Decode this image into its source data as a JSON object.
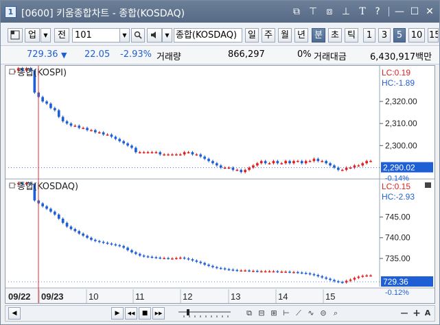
{
  "window": {
    "title": "[0600] 키움종합차트 - 종합(KOSDAQ)",
    "icon_label": "1",
    "controls": [
      "new-window-icon",
      "pin-icon",
      "restore-icon",
      "extend-icon",
      "font-icon",
      "help-icon",
      "minimize-icon",
      "maximize-icon",
      "close-icon"
    ],
    "control_glyphs": [
      "⧉",
      "⊤",
      "⧈",
      "⊥",
      "T",
      "?",
      "—",
      "☐",
      "✕"
    ]
  },
  "toolbar": {
    "type_label": "업",
    "all_label": "전",
    "code_value": "101",
    "market_name": "종합(KOSDAQ)",
    "periods": [
      "일",
      "주",
      "월",
      "년",
      "분",
      "초",
      "틱"
    ],
    "active_period": "분",
    "intervals": [
      "1",
      "3",
      "5",
      "10",
      "15"
    ],
    "active_interval": "5"
  },
  "info": {
    "price": "729.36",
    "change": "22.05",
    "change_pct": "-2.93%",
    "volume_label": "거래량",
    "volume": "866,297",
    "volume_pct": "0%",
    "amount_label": "거래대금",
    "amount": "6,430,917백만"
  },
  "chart_data": [
    {
      "type": "candlestick",
      "title": "종합(KOSPI)",
      "lc_label": "LC:0.19",
      "hc_label": "HC:-1.89",
      "y_ticks": [
        "2,320.00",
        "2,310.00",
        "2,300.00"
      ],
      "y_tick_values": [
        2320,
        2310,
        2300
      ],
      "ylim": [
        2285.5,
        2335.5
      ],
      "current_value": "2,290.02",
      "current_pct": "-0.14%",
      "current": 2290.02,
      "series": [
        2333,
        2334,
        2335,
        2334,
        2335,
        2334,
        2324,
        2322,
        2320,
        2319,
        2317,
        2316,
        2313,
        2311,
        2310,
        2309,
        2309,
        2308,
        2308,
        2307,
        2307,
        2306,
        2306,
        2305,
        2305,
        2304,
        2303,
        2302,
        2301,
        2300,
        2299,
        2297,
        2297,
        2297,
        2297,
        2297,
        2297,
        2296,
        2296,
        2296,
        2296,
        2296,
        2296,
        2297,
        2297,
        2296,
        2296,
        2295,
        2294,
        2293,
        2292,
        2291,
        2290,
        2290,
        2290,
        2289,
        2289,
        2288,
        2289,
        2290,
        2291,
        2292,
        2293,
        2292,
        2292,
        2293,
        2292,
        2292,
        2293,
        2292,
        2293,
        2293,
        2292,
        2293,
        2293,
        2294,
        2293,
        2293,
        2292,
        2291,
        2290,
        2289,
        2289,
        2290,
        2290,
        2291,
        2291,
        2292,
        2293,
        2293
      ]
    },
    {
      "type": "candlestick",
      "title": "종합(KOSDAQ)",
      "lc_label": "LC:0.15",
      "hc_label": "HC:-2.93",
      "y_ticks": [
        "745.00",
        "740.00",
        "735.00"
      ],
      "y_tick_values": [
        745,
        740,
        735
      ],
      "ylim": [
        728.2,
        753.7
      ],
      "current_value": "729.36",
      "current_pct": "-0.12%",
      "current": 729.36,
      "series": [
        752.8,
        753.0,
        753.2,
        752.9,
        753.2,
        753.0,
        749.0,
        748.3,
        747.6,
        747.0,
        746.3,
        745.6,
        744.6,
        743.6,
        742.7,
        742.1,
        741.6,
        741.0,
        740.5,
        740.0,
        739.5,
        739.2,
        739.0,
        738.8,
        738.6,
        738.4,
        738.2,
        738.0,
        737.6,
        737.0,
        736.5,
        736.1,
        735.7,
        735.5,
        735.4,
        735.3,
        735.2,
        735.1,
        735.1,
        735.0,
        735.0,
        735.1,
        735.2,
        735.0,
        734.8,
        734.5,
        734.2,
        733.9,
        733.5,
        733.2,
        732.9,
        732.7,
        732.6,
        732.4,
        732.3,
        732.2,
        732.1,
        732.1,
        732.1,
        732.0,
        732.0,
        731.9,
        731.9,
        731.9,
        731.9,
        731.9,
        731.8,
        731.8,
        731.8,
        731.7,
        731.7,
        731.6,
        731.5,
        731.4,
        731.2,
        731.0,
        730.7,
        730.4,
        730.1,
        729.8,
        729.5,
        729.3,
        729.2,
        729.6,
        729.9,
        730.3,
        730.6,
        730.8,
        730.9,
        730.9
      ]
    }
  ],
  "time_axis": {
    "labels": [
      "09/22",
      "09/23",
      "10",
      "11",
      "12",
      "13",
      "14",
      "15"
    ]
  },
  "colors": {
    "up": "#e02020",
    "down": "#1f5fd6",
    "crosshair": "#e03030",
    "accent_blue": "#1f5fd6",
    "current_bg": "#1f5fd6"
  },
  "scrollbar": {
    "buttons": [
      "scroll-left-icon",
      "scroll-right-icon",
      "play-icon",
      "rewind-icon",
      "stop-icon",
      "fast-forward-icon"
    ],
    "button_glyphs": [
      "◀",
      "▶",
      "◀◀",
      "■",
      "▶▶"
    ],
    "tools": [
      "copy-icon",
      "compare-icon",
      "settings-icon",
      "line-tool-icon",
      "trend-icon",
      "wave-icon",
      "lock-icon",
      "search-icon",
      "zoom-out-icon",
      "zoom-in-icon",
      "text-icon"
    ],
    "tool_glyphs": [
      "⧉",
      "⊟",
      "⊞",
      "⊢",
      "⟋",
      "∿",
      "⊝",
      "⌕",
      "—",
      "+",
      "A"
    ]
  }
}
